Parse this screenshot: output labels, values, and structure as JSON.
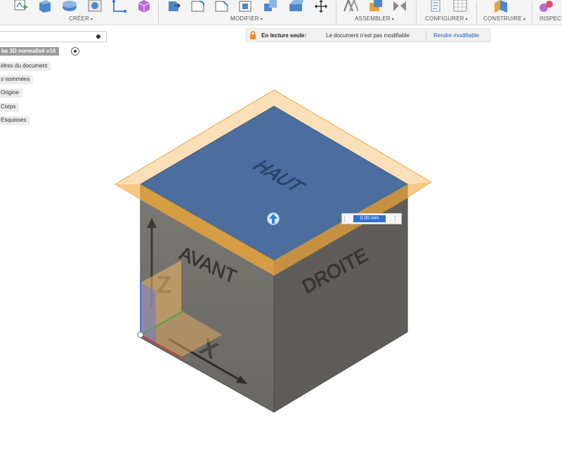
{
  "toolbar": {
    "groups": [
      {
        "label": "CRÉER",
        "caret": "▾"
      },
      {
        "label": "MODIFIER",
        "caret": "▾"
      },
      {
        "label": "ASSEMBLER",
        "caret": "▾"
      },
      {
        "label": "CONFIGURER",
        "caret": "▾"
      },
      {
        "label": "CONSTRUIRE",
        "caret": "▾"
      },
      {
        "label": "INSPECT",
        "caret": ""
      }
    ]
  },
  "browser": {
    "root": "be 3D normalisé v16",
    "items": [
      {
        "label": "ètres du document"
      },
      {
        "label": "s nommées"
      },
      {
        "label": "Origine"
      },
      {
        "label": "Corps"
      },
      {
        "label": "Esquisses"
      }
    ]
  },
  "banner": {
    "label": "En lecture seule:",
    "message": "Le document n'est pas modifiable",
    "action": "Rendre modifiable"
  },
  "viewport": {
    "cube_faces": {
      "top": "HAUT",
      "front": "AVANT",
      "right": "DROITE"
    },
    "axes": {
      "vertical": "Z",
      "horizontal": "X"
    },
    "distance_value": "0.00 mm",
    "colors": {
      "top_face": "#4b6e9f",
      "front_face": "#74726c",
      "right_face": "#5f5d5a",
      "plane_highlight": "#f6b961",
      "selection_blue": "#2f6fd1"
    }
  }
}
